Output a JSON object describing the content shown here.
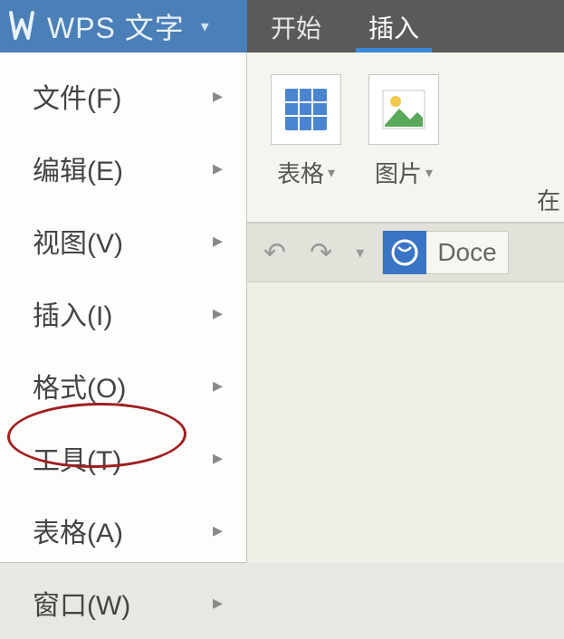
{
  "app": {
    "title": "WPS 文字",
    "logo_glyph": "W"
  },
  "tabs": [
    {
      "label": "开始",
      "active": false
    },
    {
      "label": "插入",
      "active": true
    }
  ],
  "menu": {
    "items": [
      {
        "label": "文件(F)"
      },
      {
        "label": "编辑(E)"
      },
      {
        "label": "视图(V)"
      },
      {
        "label": "插入(I)"
      },
      {
        "label": "格式(O)"
      },
      {
        "label": "工具(T)",
        "highlighted": true
      },
      {
        "label": "表格(A)"
      },
      {
        "label": "窗口(W)"
      }
    ]
  },
  "ribbon": {
    "groups": [
      {
        "label": "表格",
        "icon": "table-icon"
      },
      {
        "label": "图片",
        "icon": "picture-icon"
      }
    ],
    "partial_label": "在"
  },
  "toolbar": {
    "undo_glyph": "↶",
    "redo_glyph": "↷",
    "caret": "▾",
    "doc_label": "Doce"
  },
  "glyphs": {
    "submenu_arrow": "▸",
    "title_caret": "▾",
    "small_caret": "▾"
  }
}
